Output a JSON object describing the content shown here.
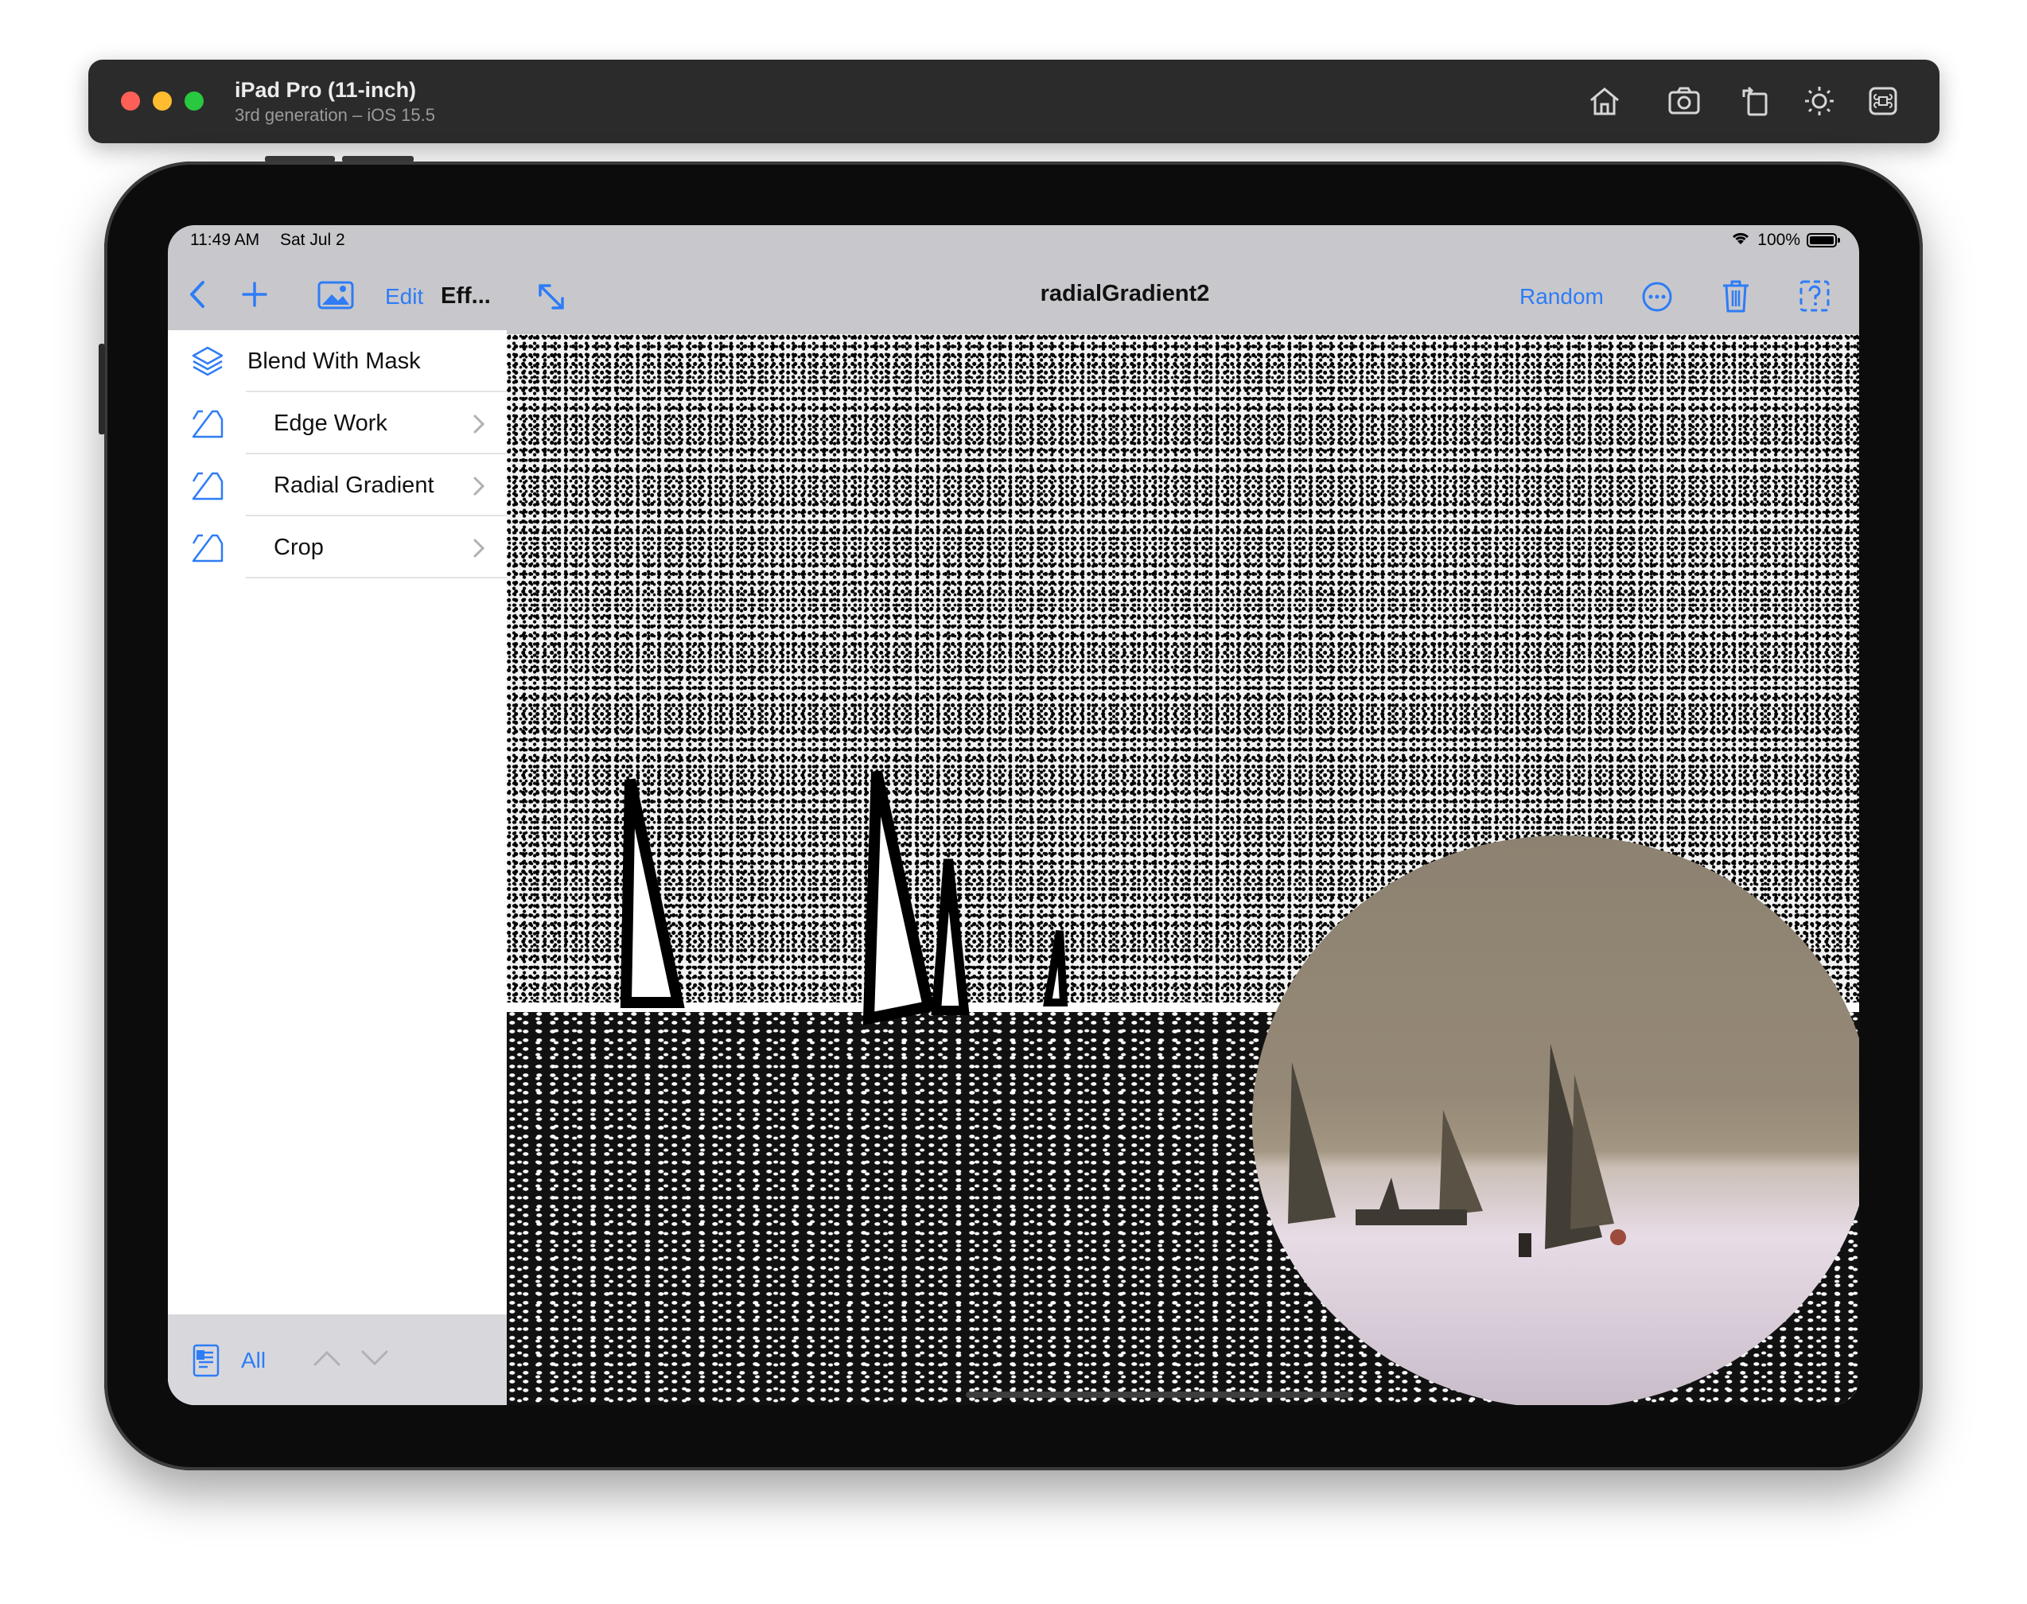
{
  "simulator": {
    "title": "iPad Pro (11-inch)",
    "subtitle": "3rd generation – iOS 15.5",
    "icons": [
      "home-icon",
      "screenshot-icon",
      "rotate-icon",
      "brightness-icon",
      "command-icon"
    ]
  },
  "status_bar": {
    "time": "11:49 AM",
    "date": "Sat Jul 2",
    "battery": "100%"
  },
  "nav": {
    "edit_label": "Edit",
    "effects_label": "Eff...",
    "title": "radialGradient2",
    "random_label": "Random"
  },
  "sidebar": {
    "items": [
      {
        "label": "Blend With Mask",
        "icon": "layers-icon"
      },
      {
        "label": "Edge Work",
        "icon": "input-tray-icon"
      },
      {
        "label": "Radial Gradient",
        "icon": "input-tray-icon"
      },
      {
        "label": "Crop",
        "icon": "input-tray-icon"
      }
    ],
    "toolbar": {
      "filter_label": "All"
    }
  },
  "colors": {
    "accent": "#2e7cf6",
    "sidebar_bg": "#ffffff",
    "navbar_bg": "#c8c8cc"
  }
}
